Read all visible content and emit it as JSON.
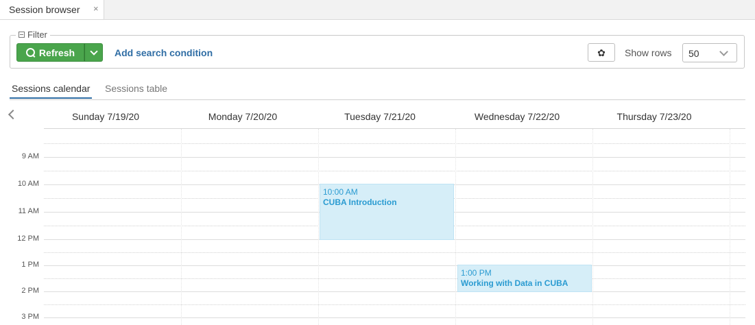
{
  "tab": {
    "title": "Session browser",
    "close": "×"
  },
  "filter": {
    "legend": "Filter",
    "refresh_label": "Refresh",
    "add_condition_label": "Add search condition",
    "show_rows_label": "Show rows",
    "rows_value": "50",
    "accent_color": "#4aa54c"
  },
  "view_tabs": [
    "Sessions calendar",
    "Sessions table"
  ],
  "calendar": {
    "days": [
      "Sunday 7/19/20",
      "Monday 7/20/20",
      "Tuesday 7/21/20",
      "Wednesday 7/22/20",
      "Thursday 7/23/20"
    ],
    "hours": [
      "9 AM",
      "10 AM",
      "11 AM",
      "12 PM",
      "1 PM",
      "2 PM",
      "3 PM"
    ],
    "events": [
      {
        "day": "Tuesday 7/21/20",
        "time": "10:00 AM",
        "title": "CUBA Introduction",
        "start": "10:00 AM",
        "end": "12:00 PM"
      },
      {
        "day": "Wednesday 7/22/20",
        "time": "1:00 PM",
        "title": "Working with Data in CUBA",
        "start": "1:00 PM",
        "end": "2:00 PM"
      }
    ],
    "event_color": "#d6eef8"
  },
  "icons": {
    "collapse": "collapse-icon",
    "refresh": "search-icon",
    "dropdown": "chevron-down-icon",
    "settings": "gear-icon",
    "prev": "chevron-left-icon"
  }
}
